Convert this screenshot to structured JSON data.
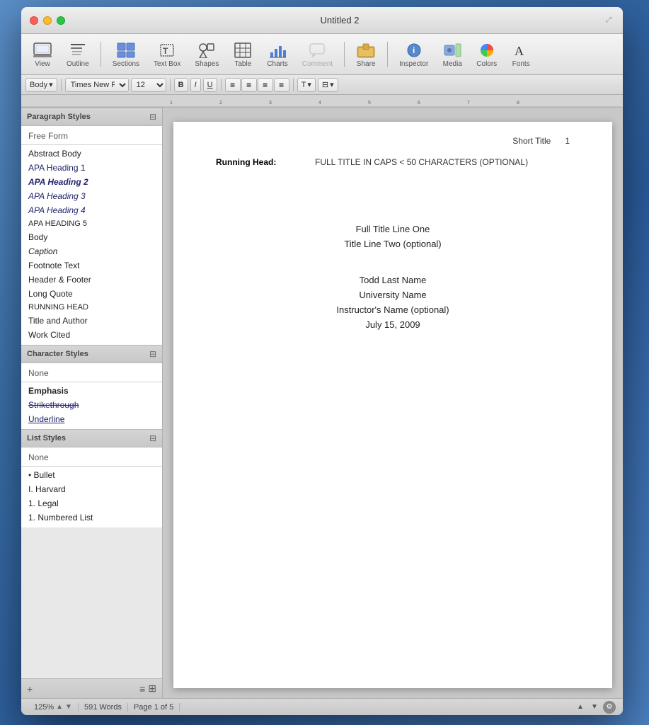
{
  "window": {
    "title": "Untitled 2",
    "expand_icon": "⤢"
  },
  "toolbar": {
    "items": [
      {
        "id": "view",
        "label": "View",
        "icon": "🖥"
      },
      {
        "id": "outline",
        "label": "Outline",
        "icon": "☰"
      },
      {
        "id": "sections",
        "label": "Sections",
        "icon": "▦"
      },
      {
        "id": "textbox",
        "label": "Text Box",
        "icon": "T"
      },
      {
        "id": "shapes",
        "label": "Shapes",
        "icon": "⬡"
      },
      {
        "id": "table",
        "label": "Table",
        "icon": "⊞"
      },
      {
        "id": "charts",
        "label": "Charts",
        "icon": "📊"
      },
      {
        "id": "comment",
        "label": "Comment",
        "icon": "💬",
        "disabled": true
      },
      {
        "id": "share",
        "label": "Share",
        "icon": "📁"
      },
      {
        "id": "inspector",
        "label": "Inspector",
        "icon": "ℹ"
      },
      {
        "id": "media",
        "label": "Media",
        "icon": "📷"
      },
      {
        "id": "colors",
        "label": "Colors",
        "icon": "🎨"
      },
      {
        "id": "fonts",
        "label": "Fonts",
        "icon": "A"
      }
    ]
  },
  "format_bar": {
    "paragraph_style": "Body",
    "font_name": "Times New Roman",
    "font_size": "12",
    "bold_label": "B",
    "italic_label": "I",
    "underline_label": "U",
    "spacing_label": "T",
    "indent_label": "⇥"
  },
  "paragraph_styles": {
    "section_title": "Paragraph Styles",
    "items": [
      {
        "label": "Free Form",
        "class": "free-form"
      },
      {
        "label": "Abstract Body",
        "class": ""
      },
      {
        "label": "APA Heading 1",
        "class": "apa-h1"
      },
      {
        "label": "APA Heading 2",
        "class": "apa-h2"
      },
      {
        "label": "APA Heading 3",
        "class": "apa-h3"
      },
      {
        "label": "APA Heading 4",
        "class": "apa-h4"
      },
      {
        "label": "APA HEADING 5",
        "class": "apa-h5"
      },
      {
        "label": "Body",
        "class": ""
      },
      {
        "label": "Caption",
        "class": "caption"
      },
      {
        "label": "Footnote Text",
        "class": ""
      },
      {
        "label": "Header & Footer",
        "class": ""
      },
      {
        "label": "Long Quote",
        "class": ""
      },
      {
        "label": "RUNNING HEAD",
        "class": "running-head"
      },
      {
        "label": "Title and Author",
        "class": ""
      },
      {
        "label": "Work Cited",
        "class": ""
      }
    ]
  },
  "character_styles": {
    "section_title": "Character Styles",
    "items": [
      {
        "label": "None",
        "class": "char-none"
      },
      {
        "label": "Emphasis",
        "class": "char-emphasis"
      },
      {
        "label": "Strikethrough",
        "class": "char-strikethrough"
      },
      {
        "label": "Underline",
        "class": "char-underline"
      }
    ]
  },
  "list_styles": {
    "section_title": "List Styles",
    "items": [
      {
        "label": "None",
        "class": "list-none"
      },
      {
        "label": "• Bullet",
        "class": ""
      },
      {
        "label": "I. Harvard",
        "class": ""
      },
      {
        "label": "1. Legal",
        "class": ""
      },
      {
        "label": "1. Numbered List",
        "class": ""
      }
    ]
  },
  "sidebar_bottom": {
    "add_label": "+",
    "list_icon": "≡",
    "grid_icon": "⊞"
  },
  "document": {
    "short_title": "Short Title",
    "page_num": "1",
    "running_head_label": "Running Head:",
    "running_head_content": "FULL TITLE IN CAPS < 50 CHARACTERS (OPTIONAL)",
    "title_line1": "Full Title Line One",
    "title_line2": "Title Line Two (optional)",
    "author": "Todd Last Name",
    "university": "University Name",
    "instructor": "Instructor's Name (optional)",
    "date": "July 15, 2009"
  },
  "status_bar": {
    "zoom": "125%",
    "words": "591 Words",
    "page": "Page 1 of 5"
  }
}
